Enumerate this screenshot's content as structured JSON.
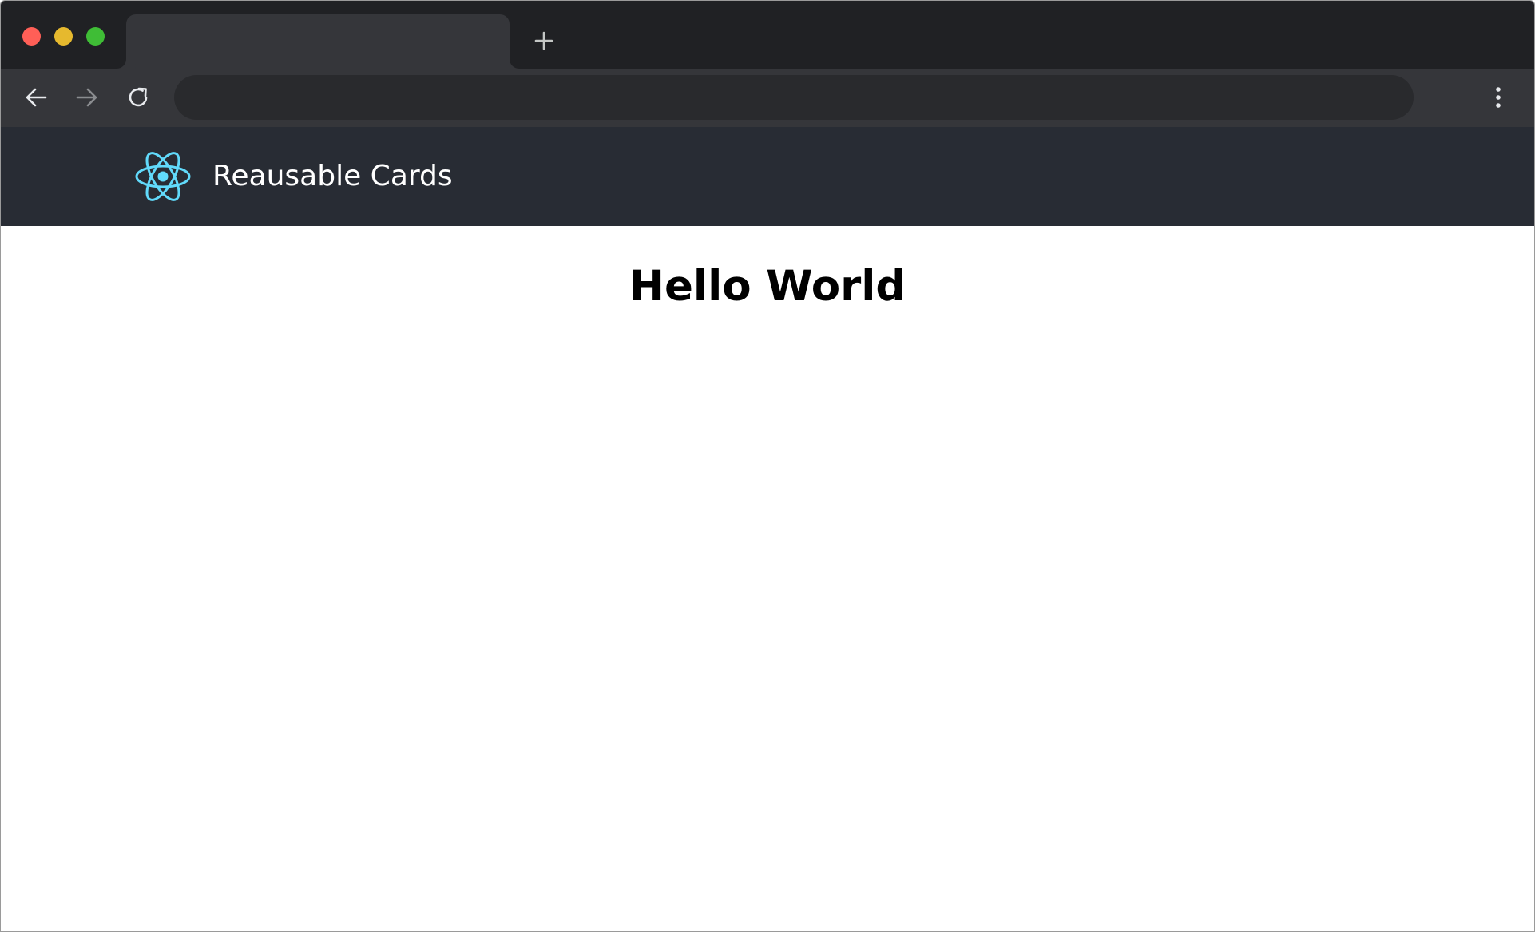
{
  "browser": {
    "window_controls": {
      "close_color": "#ff5f57",
      "minimize_color": "#e6b92e",
      "maximize_color": "#3fbd36"
    },
    "tab": {
      "title": ""
    },
    "new_tab_icon": "plus-icon",
    "nav": {
      "back_icon": "arrow-left-icon",
      "forward_icon": "arrow-right-icon",
      "reload_icon": "reload-icon",
      "menu_icon": "kebab-menu-icon"
    },
    "address_bar": {
      "value": "",
      "placeholder": ""
    }
  },
  "app": {
    "header": {
      "logo_icon": "react-atom-icon",
      "logo_color": "#61dafb",
      "title": "Reausable Cards",
      "background": "#282c34"
    },
    "main": {
      "heading": "Hello World"
    }
  }
}
